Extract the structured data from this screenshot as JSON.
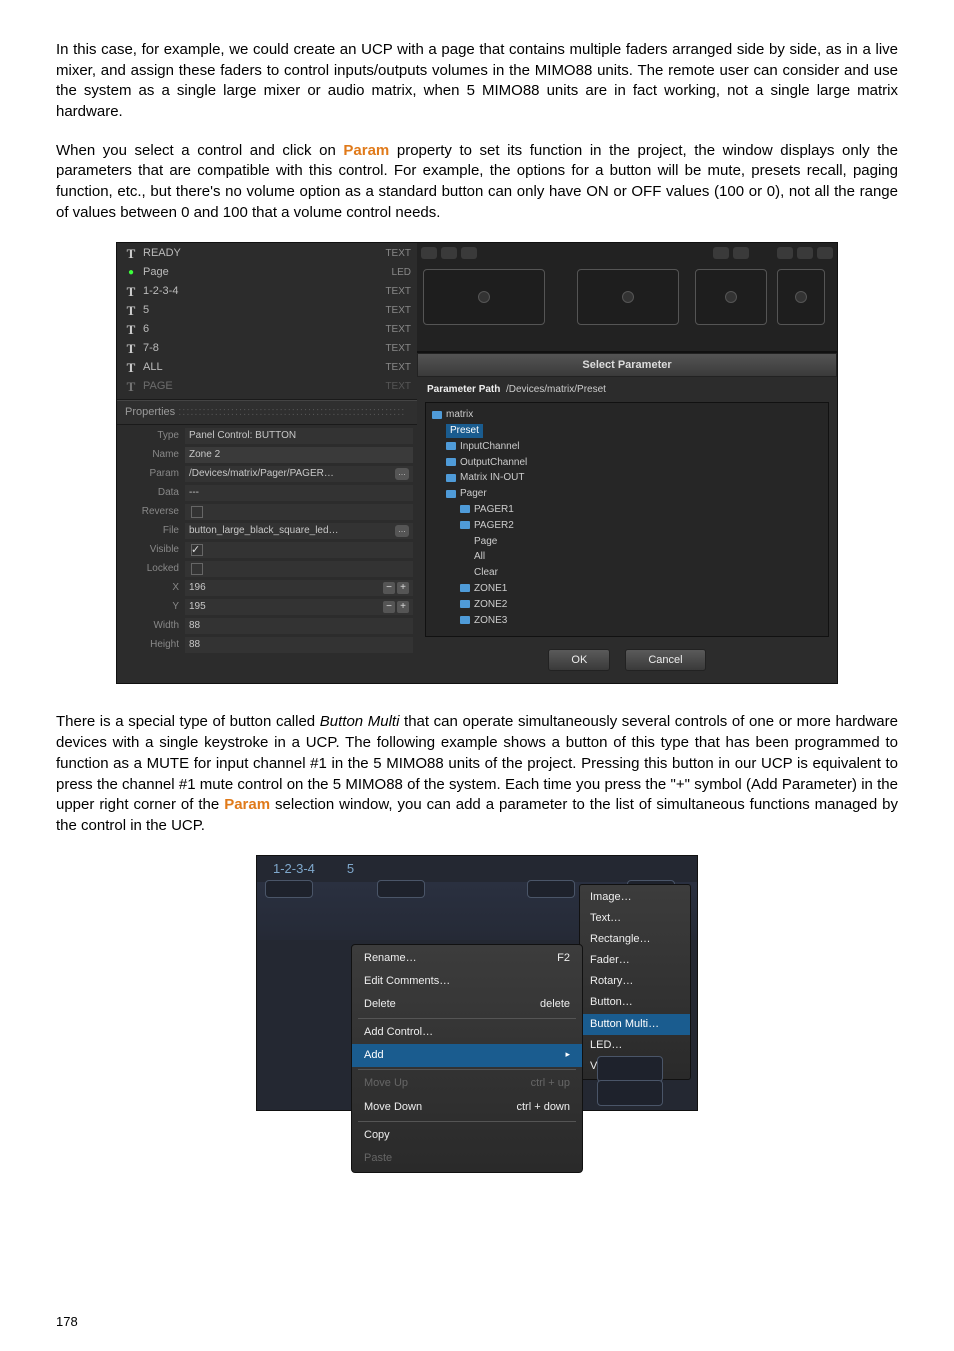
{
  "para1": "In this case, for example, we could create an UCP with a page that contains multiple faders arranged side by side, as in a live mixer, and assign these faders to control inputs/outputs volumes in the MIMO88 units. The remote user can consider and use the system as a single large mixer or audio matrix, when 5 MIMO88 units are in fact working, not a single large matrix hardware.",
  "para2a": "When you select a control and click on ",
  "para2_param": "Param",
  "para2b": " property to set its function in the project, the window displays only the parameters that are compatible with this control. For example, the options for a button will be mute, presets recall, paging function, etc., but there's no volume option as a standard button can only have ON or OFF values (100 or 0), not all the range of values between 0 and 100 that a volume control needs.",
  "para3a": "There is a special type of button called ",
  "para3_bm": "Button Multi",
  "para3b": " that can operate simultaneously several controls of one or more hardware devices with a single keystroke in a UCP. The following example shows a button of this type that has been programmed to function as a MUTE for input channel #1 in the 5 MIMO88 units of the project. Pressing this button in our UCP is equivalent to press the channel #1 mute control on the 5 MIMO88 of the system. Each time you press the \"+\" symbol (Add Parameter) in the upper right corner of the ",
  "para3_param": "Param",
  "para3c": " selection window, you can add a parameter to the list of simultaneous functions managed by the control in the UCP.",
  "page_num": "178",
  "items": [
    {
      "icon": "T",
      "label": "READY",
      "tag": "TEXT"
    },
    {
      "icon": "●",
      "led": true,
      "label": "Page",
      "tag": "LED"
    },
    {
      "icon": "T",
      "label": "1-2-3-4",
      "tag": "TEXT"
    },
    {
      "icon": "T",
      "label": "5",
      "tag": "TEXT"
    },
    {
      "icon": "T",
      "label": "6",
      "tag": "TEXT"
    },
    {
      "icon": "T",
      "label": "7-8",
      "tag": "TEXT"
    },
    {
      "icon": "T",
      "label": "ALL",
      "tag": "TEXT"
    },
    {
      "icon": "T",
      "label": "PAGE",
      "tag": "TEXT"
    }
  ],
  "props_title": "Properties",
  "props": {
    "Type": "Panel Control: BUTTON",
    "Name": "Zone 2",
    "Param": "/Devices/matrix/Pager/PAGER…",
    "Data": "---",
    "Reverse": "",
    "File": "button_large_black_square_led…",
    "Visible": "",
    "Locked": "",
    "X": "196",
    "Y": "195",
    "Width": "88",
    "Height": "88"
  },
  "dialog": {
    "title": "Select Parameter",
    "path_label": "Parameter Path",
    "path_value": "/Devices/matrix/Preset",
    "tree": {
      "root": "matrix",
      "selected": "Preset",
      "n1": "InputChannel",
      "n2": "OutputChannel",
      "n3": "Matrix IN-OUT",
      "n4": "Pager",
      "n4a": "PAGER1",
      "n4b": "PAGER2",
      "n4b1": "Page",
      "n4b2": "All",
      "n4b3": "Clear",
      "n4c": "ZONE1",
      "n4d": "ZONE2",
      "n4e": "ZONE3"
    },
    "ok": "OK",
    "cancel": "Cancel"
  },
  "fig2": {
    "tabs": [
      "1-2-3-4",
      "5"
    ],
    "submenu": [
      "Image…",
      "Text…",
      "Rectangle…",
      "Fader…",
      "Rotary…",
      "Button…",
      "Button Multi…",
      "LED…",
      "Vumeter…"
    ],
    "submenu_hl": "Button Multi…",
    "ctx": [
      {
        "label": "Rename…",
        "accel": "F2"
      },
      {
        "label": "Edit Comments…",
        "accel": ""
      },
      {
        "label": "Delete",
        "accel": "delete"
      },
      {
        "sep": true
      },
      {
        "label": "Add Control…",
        "accel": ""
      },
      {
        "label": "Add",
        "accel": "▸",
        "hl": true
      },
      {
        "sep": true
      },
      {
        "label": "Move Up",
        "accel": "ctrl + up",
        "dis": true
      },
      {
        "label": "Move Down",
        "accel": "ctrl + down"
      },
      {
        "sep": true
      },
      {
        "label": "Copy",
        "accel": ""
      },
      {
        "label": "Paste",
        "accel": "",
        "dis": true
      }
    ]
  }
}
